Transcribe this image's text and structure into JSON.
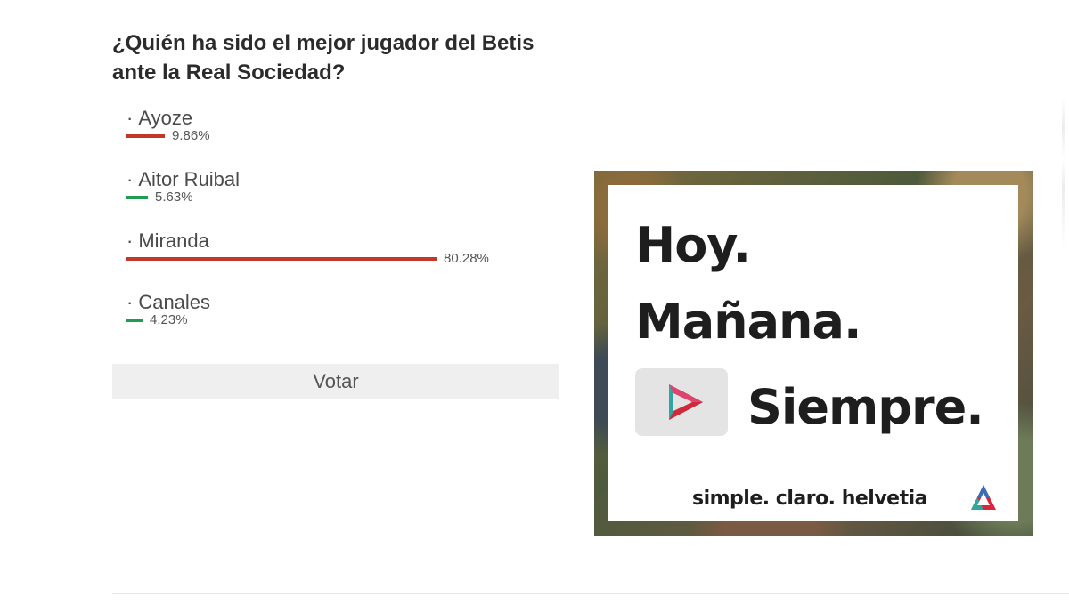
{
  "poll": {
    "title": "¿Quién ha sido el mejor jugador del Betis ante la Real Sociedad?",
    "options": [
      {
        "name": "Ayoze",
        "percent": 9.86,
        "percent_label": "9.86%",
        "color": "#c0392b"
      },
      {
        "name": "Aitor Ruibal",
        "percent": 5.63,
        "percent_label": "5.63%",
        "color": "#1e9e50"
      },
      {
        "name": "Miranda",
        "percent": 80.28,
        "percent_label": "80.28%",
        "color": "#c0392b"
      },
      {
        "name": "Canales",
        "percent": 4.23,
        "percent_label": "4.23%",
        "color": "#1e9e50"
      }
    ],
    "vote_label": "Votar",
    "bullet": "·"
  },
  "ad": {
    "line1": "Hoy.",
    "line2": "Mañana.",
    "line3": "Siempre.",
    "tagline": "simple. claro. helvetia",
    "play_icon": "play-triangle-icon",
    "logo_icon": "helvetia-logo-icon"
  }
}
